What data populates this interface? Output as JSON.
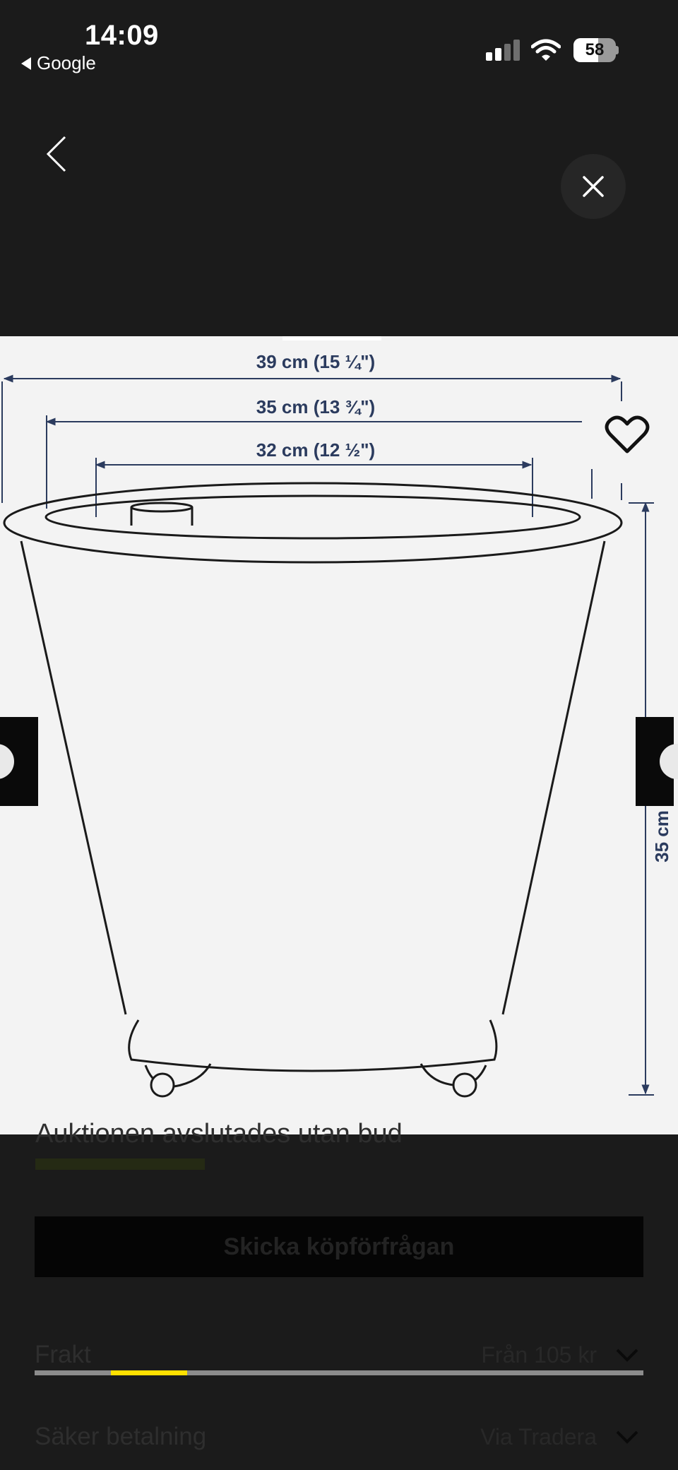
{
  "status_bar": {
    "time": "14:09",
    "back_app": "Google",
    "battery_level": "58",
    "battery_fraction": 0.58,
    "signal_bars_active": 2,
    "signal_bars_total": 4
  },
  "viewer": {
    "dimensions": {
      "outer_width": "39 cm (15 ¼\")",
      "rim_width": "35 cm (13 ¾\")",
      "inner_width": "32 cm (12 ½\")",
      "height": "35 cm"
    },
    "line_color": "#2b3b5e",
    "background": "#f3f3f3"
  },
  "listing": {
    "auction_status": "Auktionen avslutades utan bud",
    "request_button": "Skicka köpförfrågan",
    "shipping_label": "Frakt",
    "shipping_value": "Från 105 kr",
    "payment_label": "Säker betalning",
    "payment_value": "Via Tradera",
    "accent_color": "#ffe000",
    "active_tab_index": 1,
    "tab_count": 8
  },
  "icons": {
    "nav_back": "chevron-left-icon",
    "close": "close-icon",
    "favorite": "heart-icon",
    "expand": "chevron-down-icon"
  }
}
